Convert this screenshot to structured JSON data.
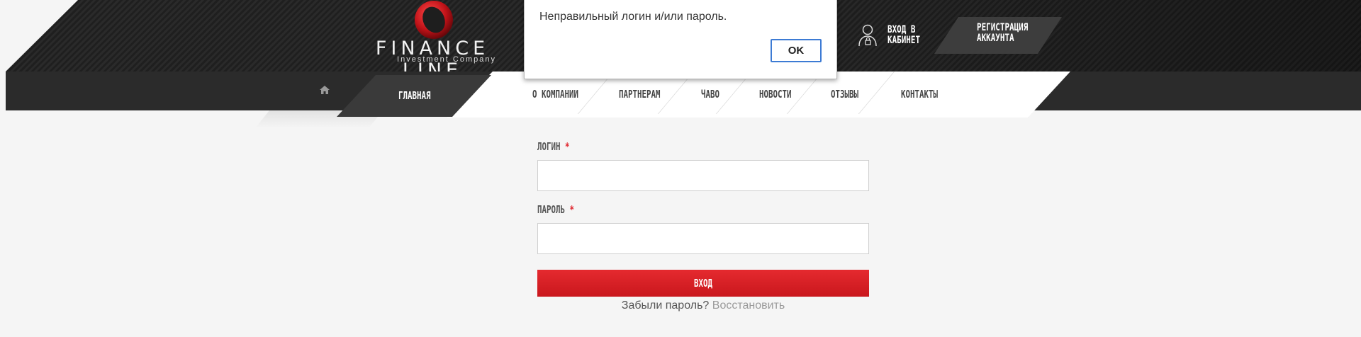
{
  "brand": {
    "name": "FINANCE LINE",
    "tagline": "Investment Company"
  },
  "header": {
    "login_link": "ВХОД В КАБИНЕТ",
    "register_button": "РЕГИСТРАЦИЯ АККАУНТА"
  },
  "nav": {
    "items": [
      "ГЛАВНАЯ",
      "О КОМПАНИИ",
      "ПАРТНЕРАМ",
      "ЧАВО",
      "НОВОСТИ",
      "ОТЗЫВЫ",
      "КОНТАКТЫ"
    ],
    "active": "ГЛАВНАЯ"
  },
  "form": {
    "login_label": "ЛОГИН",
    "login_value": "",
    "password_label": "ПАРОЛЬ",
    "password_value": "",
    "required_mark": "*",
    "submit_label": "ВХОД",
    "forgot_text": "Забыли пароль?",
    "recover_link": "Восстановить"
  },
  "alert": {
    "message": "Неправильный логин и/или пароль.",
    "ok_label": "OK"
  },
  "colors": {
    "accent": "#e0262e",
    "header_dark": "#222222",
    "nav_dark": "#2b2b2b"
  }
}
